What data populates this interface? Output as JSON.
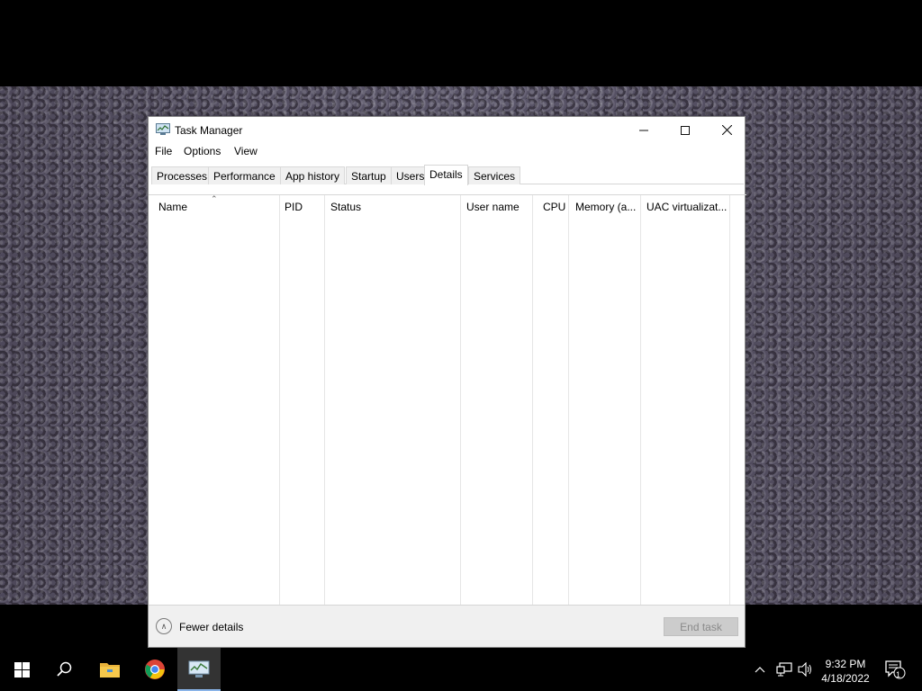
{
  "window": {
    "title": "Task Manager",
    "controls": {
      "minimize": "minimize-icon",
      "maximize": "maximize-icon",
      "close": "close-icon"
    }
  },
  "menu": [
    "File",
    "Options",
    "View"
  ],
  "tabs": [
    {
      "label": "Processes",
      "active": false
    },
    {
      "label": "Performance",
      "active": false
    },
    {
      "label": "App history",
      "active": false
    },
    {
      "label": "Startup",
      "active": false
    },
    {
      "label": "Users",
      "active": false
    },
    {
      "label": "Details",
      "active": true
    },
    {
      "label": "Services",
      "active": false
    }
  ],
  "columns": [
    "Name",
    "PID",
    "Status",
    "User name",
    "CPU",
    "Memory (a...",
    "UAC virtualizat..."
  ],
  "rows": [],
  "footer": {
    "fewer_details": "Fewer details",
    "end_task": "End task"
  },
  "taskbar": {
    "apps": [
      "start-icon",
      "search-icon",
      "file-explorer-icon",
      "chrome-icon",
      "task-manager-icon"
    ],
    "active_app": "task-manager-icon",
    "tray": [
      "chevron-up-icon",
      "network-icon",
      "volume-icon"
    ],
    "time": "9:32 PM",
    "date": "4/18/2022",
    "notification_count": "1"
  },
  "colors": {
    "taskbar": "#000000",
    "accent_underline": "#8ab4e8",
    "window_bg": "#ffffff",
    "footer_bg": "#f0f0f0"
  }
}
